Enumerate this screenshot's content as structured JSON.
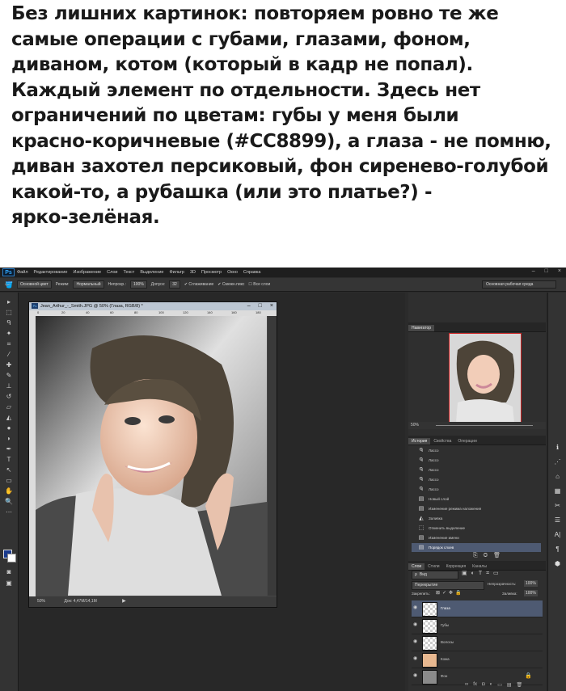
{
  "caption": {
    "lines": [
      "Без лишних картинок: повторяем ровно те же",
      "самые операции с губами, глазами, фоном,",
      "диваном, котом (который в кадр не попал).",
      "Каждый элемент по отдельности. Здесь нет",
      "ограничений по цветам: губы у меня были",
      "красно-коричневые (#CC8899), а глаза - не помню,",
      "диван захотел персиковый, фон сиренево-голубой",
      "какой-то, а рубашка (или это платье?) -",
      "ярко-зелёная."
    ]
  },
  "app": {
    "logo": "Ps",
    "menu": [
      "Файл",
      "Редактирование",
      "Изображение",
      "Слои",
      "Текст",
      "Выделение",
      "Фильтр",
      "3D",
      "Просмотр",
      "Окно",
      "Справка"
    ],
    "window_controls": [
      "–",
      "□",
      "×"
    ]
  },
  "options": {
    "preset": "Основной цвет",
    "mode_label": "Режим:",
    "mode_value": "Нормальный",
    "opacity_label": "Непрозр.:",
    "opacity_value": "100%",
    "tolerance_label": "Допуск:",
    "tolerance_value": "32",
    "antialias": "Сглаживание",
    "contiguous": "Смежн.пикс",
    "all_layers": "Все слои",
    "workspace": "Основная рабочая среда"
  },
  "document": {
    "title": "Jean_Arthur_-_Smith.JPG @ 50% (Глаза, RGB/8) *",
    "ruler_marks": [
      "0",
      "20",
      "40",
      "60",
      "80",
      "100",
      "120",
      "140",
      "160",
      "180"
    ],
    "zoom": "50%",
    "doc_size": "Док: 4,47M/14,1M"
  },
  "navigator": {
    "tab": "Навигатор",
    "zoom": "50%"
  },
  "history": {
    "tabs": [
      "История",
      "Свойства",
      "Операции"
    ],
    "items": [
      "Лассо",
      "Лассо",
      "Лассо",
      "Лассо",
      "Лассо",
      "Новый слой",
      "Изменение режима наложения",
      "Заливка",
      "Отменить выделение",
      "Изменение имени",
      "Порядок слоев"
    ]
  },
  "layers": {
    "tabs": [
      "Слои",
      "Стили",
      "Коррекция",
      "Каналы"
    ],
    "filter": "Вид",
    "blend": "Перекрытие",
    "opacity_label": "Непрозрачность:",
    "opacity_value": "100%",
    "lock_label": "Закрепить:",
    "fill_label": "Заливка:",
    "fill_value": "100%",
    "items": [
      "Глаза",
      "Губы",
      "Волосы",
      "Кожа",
      "Фон"
    ],
    "footer_icons": [
      "∞",
      "fx",
      "◘",
      "◐",
      "▭",
      "▤",
      "🗑"
    ]
  },
  "colors": {
    "accent": "#31a8ff",
    "selection": "#4e5a72",
    "fg_swatch": "#1a3a8c"
  }
}
